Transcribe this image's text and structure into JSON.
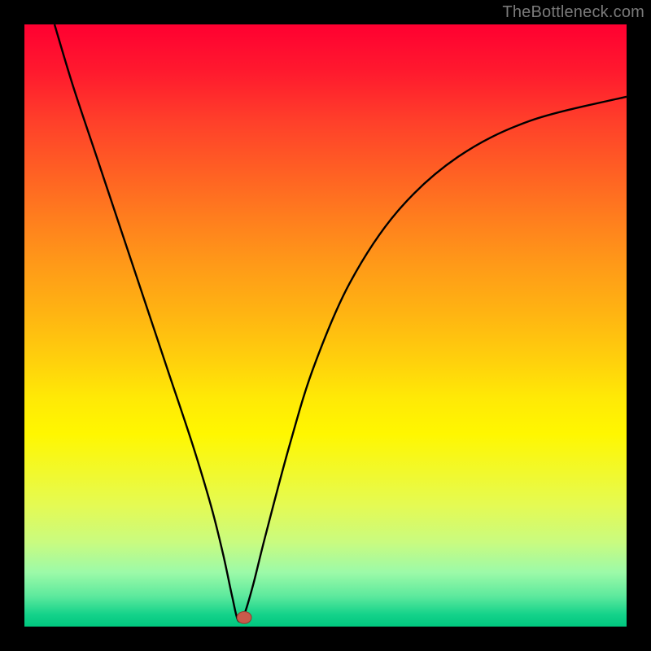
{
  "watermark": "TheBottleneck.com",
  "colors": {
    "background": "#000000",
    "curve": "#000000",
    "marker_fill": "#c95a4b",
    "marker_stroke": "#8d3d31"
  },
  "chart_data": {
    "type": "line",
    "title": "",
    "xlabel": "",
    "ylabel": "",
    "xlim": [
      0,
      100
    ],
    "ylim": [
      0,
      100
    ],
    "grid": false,
    "legend": false,
    "note": "Axis values are not labeled in the source image; x/y expressed as percentages of the plot area. y=0 at bottom, y=100 at top.",
    "series": [
      {
        "name": "curve",
        "x": [
          5,
          8,
          12,
          16,
          20,
          24,
          28,
          31,
          33,
          34.5,
          35.5,
          36.5,
          38,
          40,
          44,
          48,
          54,
          62,
          72,
          84,
          100
        ],
        "y": [
          100,
          90,
          78,
          66,
          54,
          42,
          30,
          20,
          12,
          5,
          1,
          2,
          7,
          15,
          30,
          43,
          57,
          69,
          78,
          84,
          88
        ]
      }
    ],
    "marker": {
      "x": 36.5,
      "y": 1.5,
      "rx": 1.2,
      "ry": 1.0
    },
    "gradient_stops": [
      {
        "pos": 0.0,
        "color": "#ff0031"
      },
      {
        "pos": 0.5,
        "color": "#ffb412"
      },
      {
        "pos": 0.7,
        "color": "#fff700"
      },
      {
        "pos": 1.0,
        "color": "#00c77f"
      }
    ]
  }
}
